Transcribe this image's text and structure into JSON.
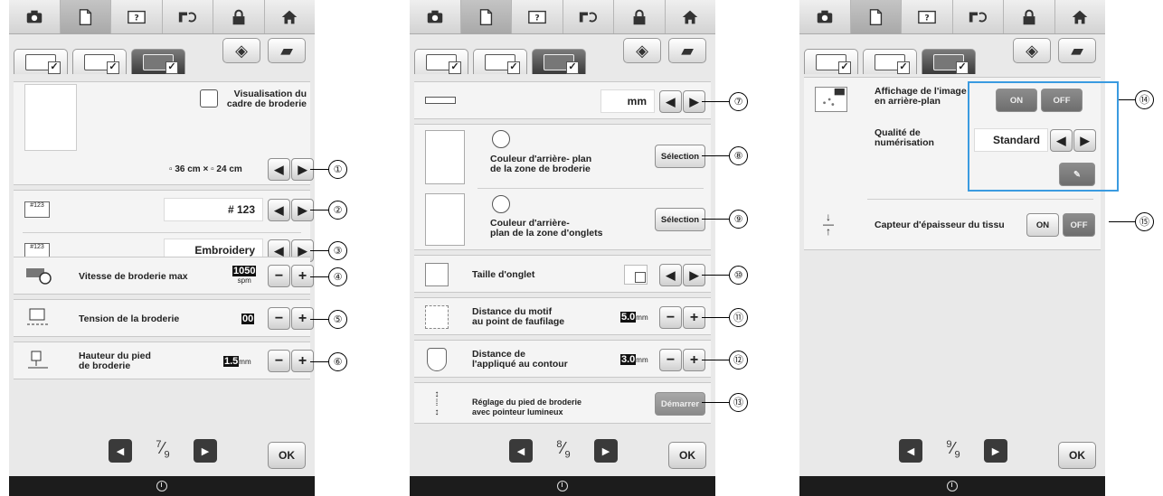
{
  "toolbar_icons": [
    "camera-icon",
    "page-icon",
    "help-icon",
    "sewing-machine-icon",
    "lock-icon",
    "home-icon"
  ],
  "screens": {
    "s1": {
      "frame_display": {
        "label_line1": "Visualisation du",
        "label_line2": "cadre de broderie",
        "size_w": "36 cm",
        "times": "×",
        "size_h": "24 cm"
      },
      "thread_number": {
        "value": "# 123"
      },
      "thread_display": {
        "value": "Embroidery"
      },
      "max_speed": {
        "label": "Vitesse de broderie max",
        "value": "1050",
        "unit": "spm"
      },
      "tension": {
        "label": "Tension de la broderie",
        "value": "00"
      },
      "foot_height": {
        "label_line1": "Hauteur du pied",
        "label_line2": "de broderie",
        "value": "1.5",
        "unit": "mm"
      },
      "page": {
        "current": "7",
        "total": "9"
      },
      "ok": "OK"
    },
    "s2": {
      "units": {
        "value": "mm"
      },
      "bg_color_area": {
        "label_line1": "Couleur d'arrière- plan",
        "label_line2": "de la zone de broderie",
        "button": "Sélection"
      },
      "bg_color_tab": {
        "label_line1": "Couleur d'arrière-",
        "label_line2": "plan de la zone d'onglets",
        "button": "Sélection"
      },
      "thumb_size": {
        "label": "Taille d'onglet"
      },
      "basting_distance": {
        "label_line1": "Distance du motif",
        "label_line2": "au point de faufilage",
        "value": "5.0",
        "unit": "mm"
      },
      "applique_distance": {
        "label_line1": "Distance de",
        "label_line2": "l'appliqué au contour",
        "value": "3.0",
        "unit": "mm"
      },
      "foot_adjust": {
        "label_line1": "Réglage du pied de broderie",
        "label_line2": "avec pointeur lumineux",
        "button": "Démarrer"
      },
      "page": {
        "current": "8",
        "total": "9"
      },
      "ok": "OK"
    },
    "s3": {
      "bg_image": {
        "label_line1": "Affichage de l'image",
        "label_line2": "en arrière-plan",
        "on": "ON",
        "off": "OFF"
      },
      "scan_quality": {
        "label_line1": "Qualité de",
        "label_line2": "numérisation",
        "value": "Standard"
      },
      "fabric_sensor": {
        "label": "Capteur d'épaisseur du tissu",
        "on": "ON",
        "off": "OFF"
      },
      "page": {
        "current": "9",
        "total": "9"
      },
      "ok": "OK"
    }
  },
  "callouts": [
    "①",
    "②",
    "③",
    "④",
    "⑤",
    "⑥",
    "⑦",
    "⑧",
    "⑨",
    "⑩",
    "⑪",
    "⑫",
    "⑬",
    "⑭",
    "⑮"
  ]
}
